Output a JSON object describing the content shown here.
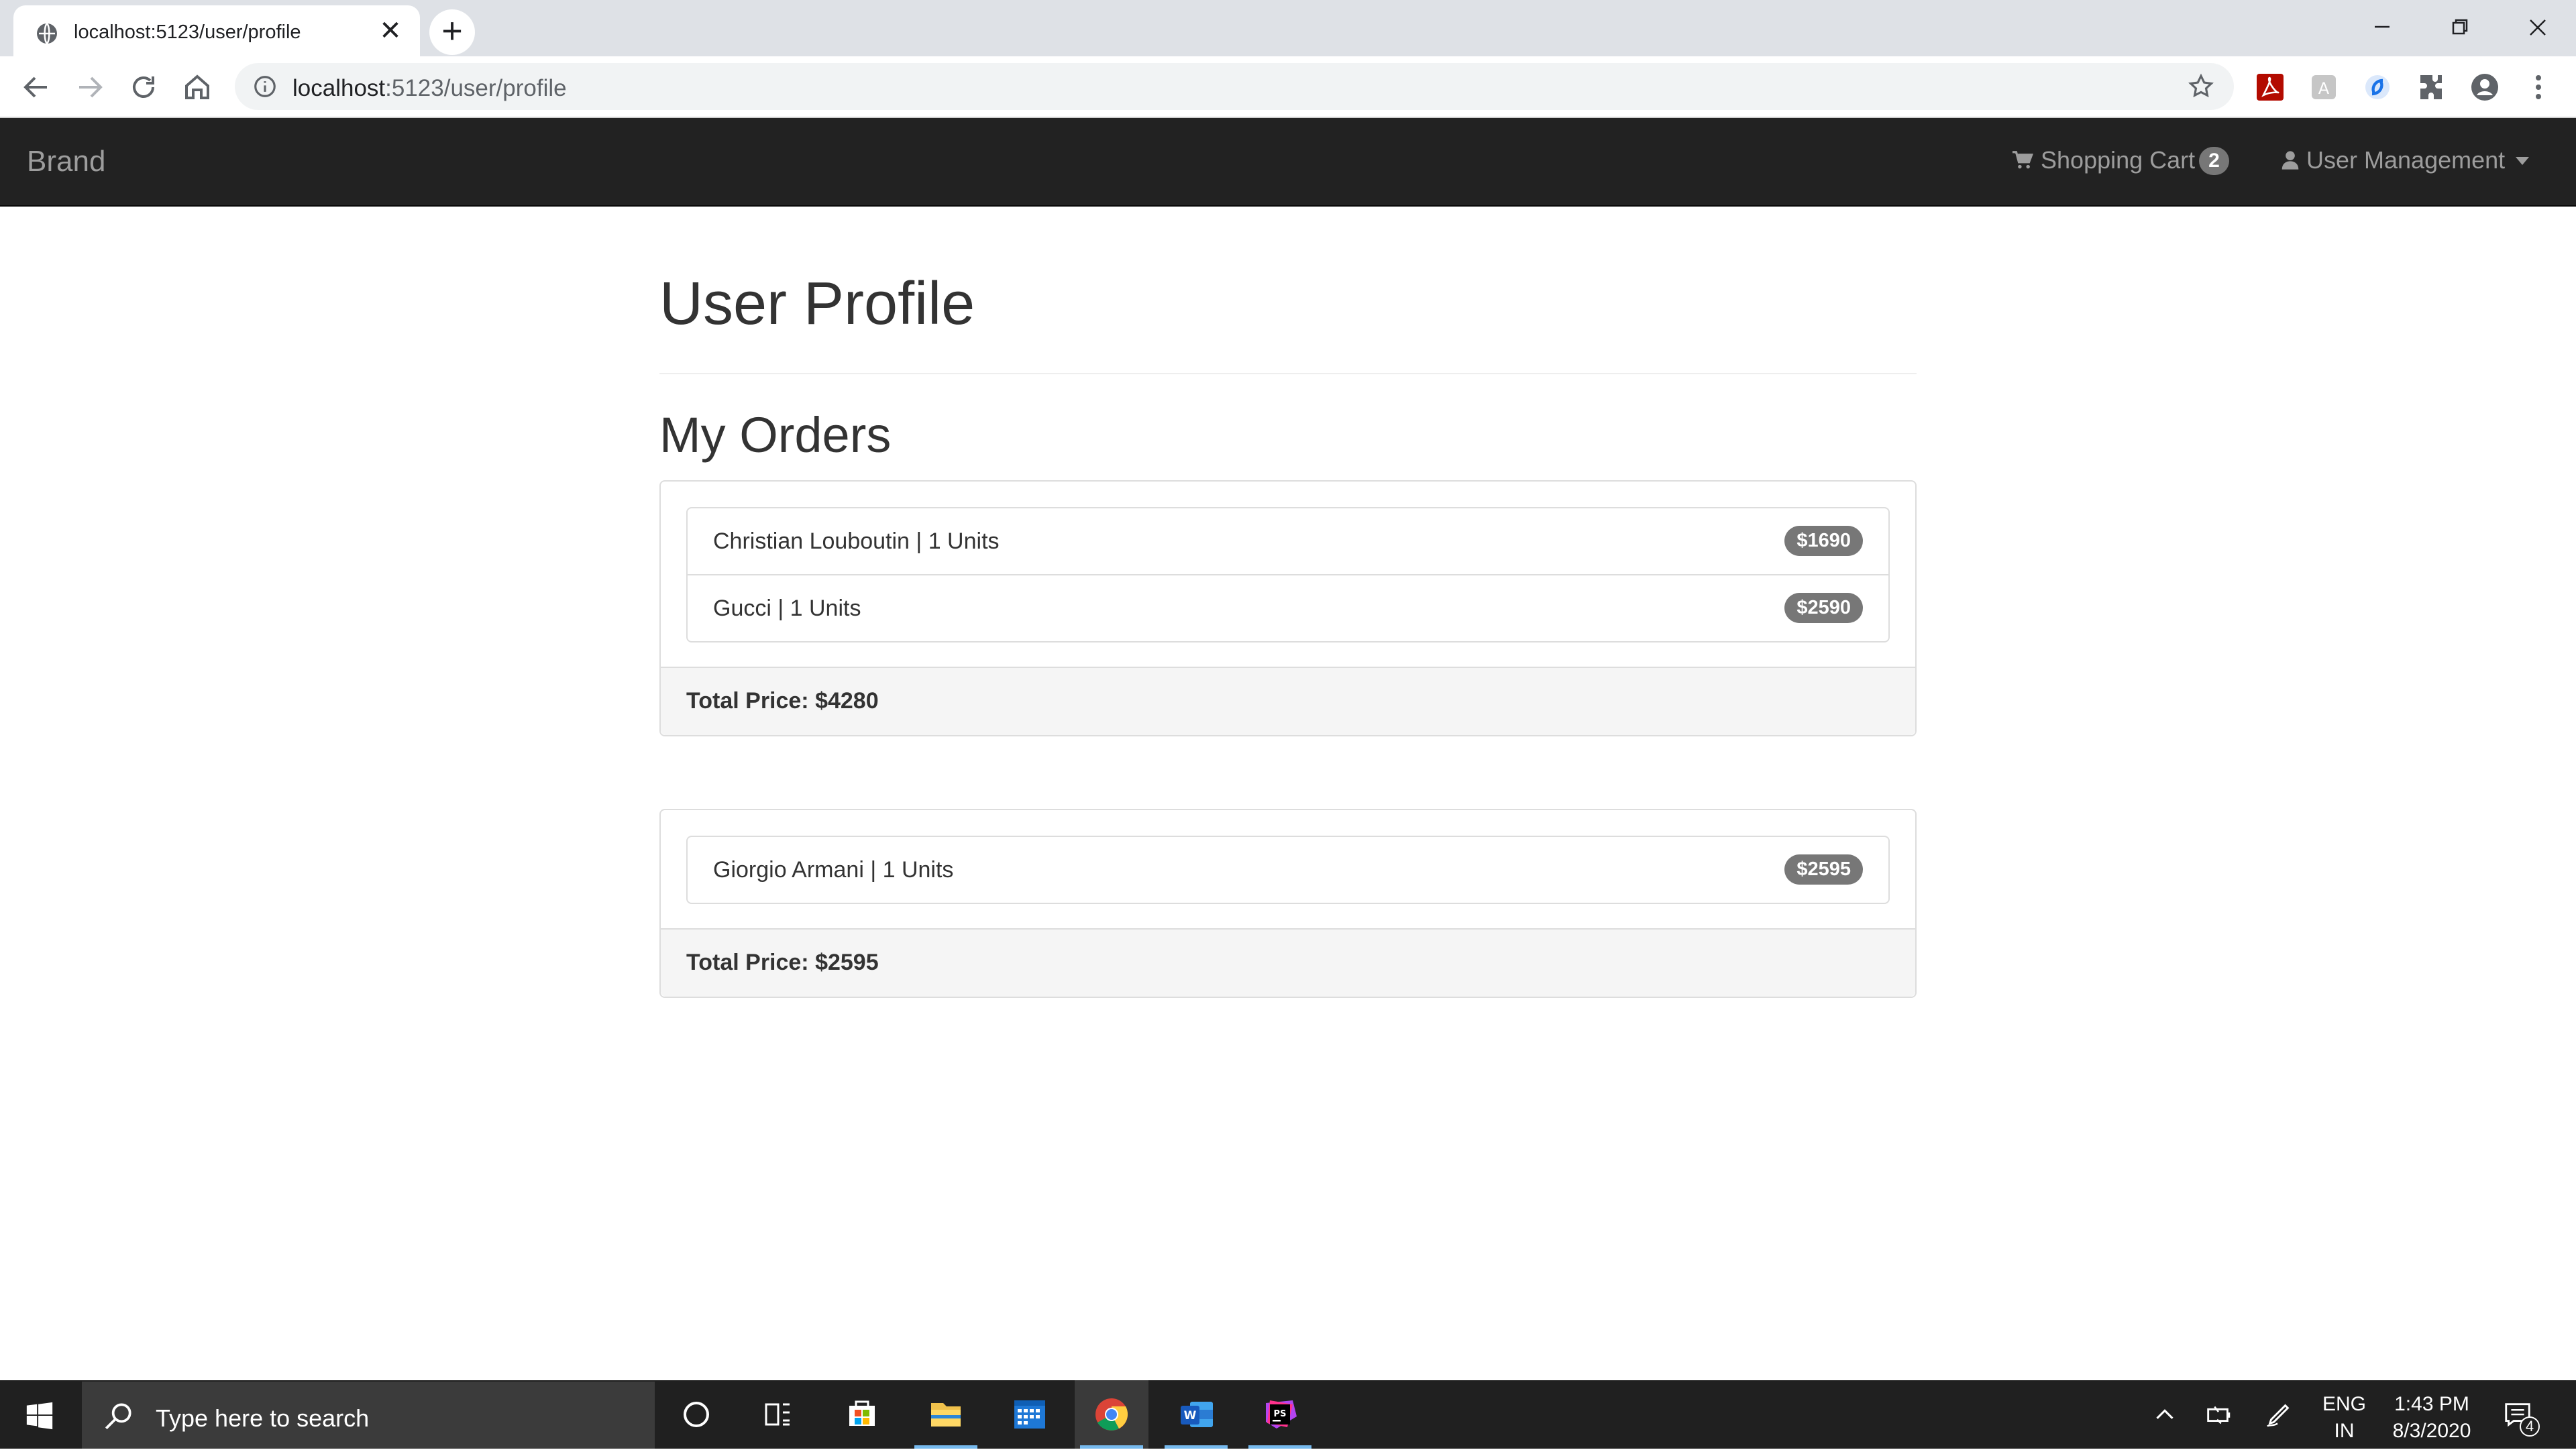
{
  "browser": {
    "tab_title": "localhost:5123/user/profile",
    "url_host": "localhost",
    "url_rest": ":5123/user/profile",
    "tab_close": "✕",
    "new_tab": "+"
  },
  "navbar": {
    "brand": "Brand",
    "cart_label": "Shopping Cart",
    "cart_count": "2",
    "user_menu": "User Management"
  },
  "page": {
    "title": "User Profile",
    "section_title": "My Orders"
  },
  "orders": [
    {
      "items": [
        {
          "text": "Christian Louboutin | 1 Units",
          "price": "$1690"
        },
        {
          "text": "Gucci | 1 Units",
          "price": "$2590"
        }
      ],
      "total": "Total Price: $4280"
    },
    {
      "items": [
        {
          "text": "Giorgio Armani | 1 Units",
          "price": "$2595"
        }
      ],
      "total": "Total Price: $2595"
    }
  ],
  "taskbar": {
    "search_placeholder": "Type here to search",
    "lang_line1": "ENG",
    "lang_line2": "IN",
    "time": "1:43 PM",
    "date": "8/3/2020",
    "notification_count": "4"
  },
  "colors": {
    "navbar_bg": "#222222",
    "badge_bg": "#777777",
    "panel_footer_bg": "#f5f5f5"
  }
}
